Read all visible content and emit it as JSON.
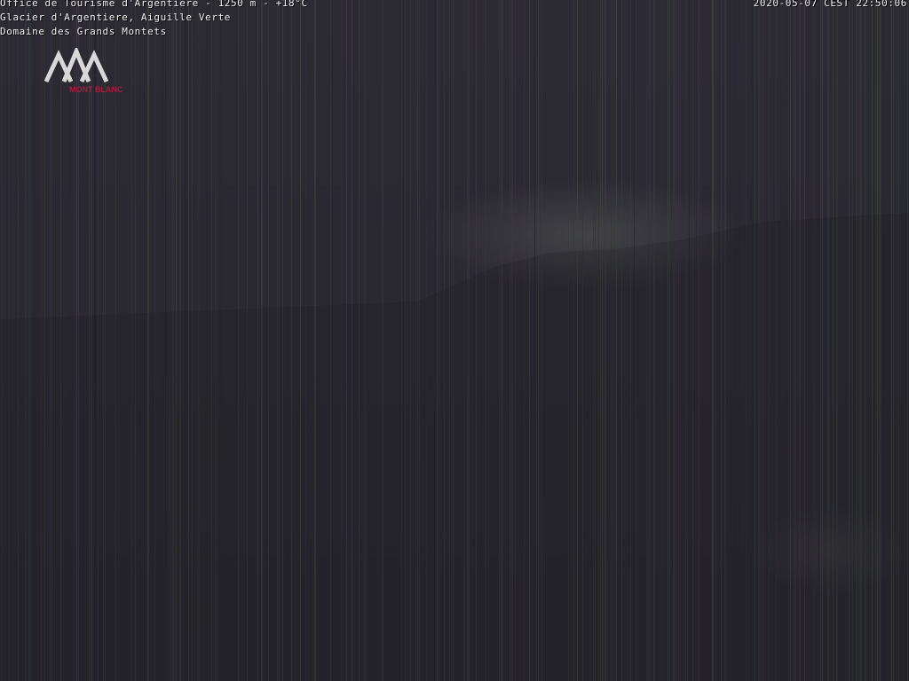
{
  "overlay": {
    "caption_line1": "Office de Tourisme d'Argentiere - 1250 m - +18°C",
    "caption_line2": "Glacier d'Argentiere, Aiguille Verte",
    "caption_line3": "Domaine des Grands Montets",
    "timestamp": "2020-05-07 CEST 22:50:06"
  },
  "logo": {
    "icon": "mountain-logo-icon",
    "text": "MONT BLANC",
    "mark_color": "#d8d8d8",
    "text_color": "#b01a3a"
  },
  "scene": {
    "description_icon": "night-webcam-noise",
    "base_color": "#2a2830"
  }
}
